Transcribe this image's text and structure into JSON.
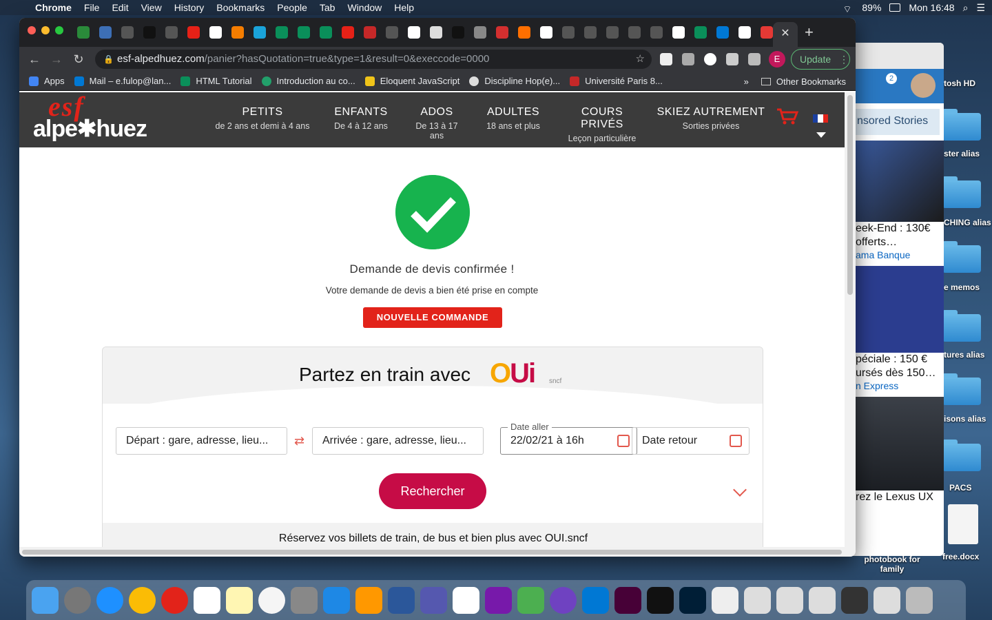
{
  "menubar": {
    "app": "Chrome",
    "items": [
      "File",
      "Edit",
      "View",
      "History",
      "Bookmarks",
      "People",
      "Tab",
      "Window",
      "Help"
    ],
    "battery": "89%",
    "clock": "Mon 16:48"
  },
  "desktop": {
    "labels": [
      "tosh HD",
      "ster alias",
      "CHING alias",
      "e memos",
      "tures alias",
      "isons alias",
      "PACS",
      "free.docx",
      "photobook for family"
    ]
  },
  "background_window": {
    "badge": "2",
    "stories": "nsored Stories",
    "ad1_title": "eek-End : 130€ offerts…",
    "ad1_source": "ama Banque",
    "ad2_title": "péciale : 150 € ursés dès 150…",
    "ad2_source": "n Express",
    "ad3_title": "rez le Lexus UX"
  },
  "browser": {
    "url_domain": "esf-alpedhuez.com",
    "url_path": "/panier?hasQuotation=true&type=1&result=0&execcode=0000",
    "profile_initial": "E",
    "update_label": "Update",
    "bookmarks": [
      "Apps",
      "Mail – e.fulop@lan...",
      "HTML Tutorial",
      "Introduction au co...",
      "Eloquent JavaScript",
      "Discipline Hop(e)...",
      "Université Paris 8..."
    ],
    "other_bookmarks": "Other Bookmarks",
    "overflow": "»"
  },
  "site": {
    "logo_top": "esf",
    "logo_bottom": "alpe✱huez",
    "nav": [
      {
        "title": "PETITS",
        "sub": "de 2 ans et demi à 4 ans"
      },
      {
        "title": "ENFANTS",
        "sub": "De 4 à 12 ans"
      },
      {
        "title": "ADOS",
        "sub": "De 13 à 17 ans"
      },
      {
        "title": "ADULTES",
        "sub": "18 ans et plus"
      },
      {
        "title": "COURS PRIVÉS",
        "sub": "Leçon particulière"
      },
      {
        "title": "SKIEZ AUTREMENT",
        "sub": "Sorties privées"
      }
    ],
    "confirm_title": "Demande de devis confirmée !",
    "confirm_sub": "Votre demande de devis a bien été prise en compte",
    "new_order": "NOUVELLE COMMANDE"
  },
  "widget": {
    "title": "Partez en train avec",
    "brand_o": "O",
    "brand_ui": "Ui",
    "brand_sncf": "sncf",
    "departure_placeholder": "Départ : gare, adresse, lieu...",
    "arrival_placeholder": "Arrivée : gare, adresse, lieu...",
    "date_out_label": "Date aller",
    "date_out_value": "22/02/21 à 16h",
    "date_return_placeholder": "Date retour",
    "search_label": "Rechercher",
    "footer": "Réservez vos billets de train, de bus et bien plus avec OUI.sncf"
  },
  "colors": {
    "esf_red": "#e2231a",
    "success_green": "#17b34e",
    "oui_red": "#c60c46",
    "oui_orange": "#f7a600"
  }
}
